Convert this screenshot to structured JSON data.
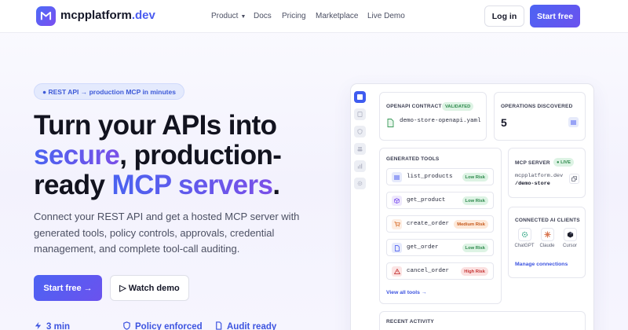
{
  "header": {
    "brand_name": "mcpplatform",
    "brand_tld": ".dev",
    "nav": [
      {
        "label": "Product",
        "has_caret": true
      },
      {
        "label": "Docs"
      },
      {
        "label": "Pricing"
      },
      {
        "label": "Marketplace"
      },
      {
        "label": "Live Demo"
      }
    ],
    "login_label": "Log in",
    "start_label": "Start free"
  },
  "hero": {
    "pill": "● REST API → production MCP in minutes",
    "headline": {
      "line1": "Turn your APIs into",
      "line2_grad": "secure",
      "line2_rest": ", production-",
      "line3_start": "ready ",
      "line3_grad": "MCP servers",
      "line3_end": "."
    },
    "subtext": "Connect your REST API and get a hosted MCP server with generated tools, policy controls, approvals, credential management, and complete tool-call auditing.",
    "cta_primary": "Start free →",
    "cta_secondary": "▷ Watch demo",
    "features": [
      "3 min",
      "Policy enforced",
      "Audit ready"
    ]
  },
  "dashboard": {
    "rail_icons": [
      "grid-icon",
      "file-icon",
      "shield-icon",
      "users-icon",
      "chart-icon",
      "gear-icon"
    ],
    "openapi": {
      "title": "OPENAPI CONTRACT",
      "badge": "VALIDATED",
      "file": "demo-store-openapi.yaml"
    },
    "operations": {
      "title": "OPERATIONS DISCOVERED",
      "count": "5"
    },
    "tools": {
      "title": "GENERATED TOOLS",
      "items": [
        {
          "name": "list_products",
          "risk": "Low Risk",
          "level": "low",
          "icon": "list-icon"
        },
        {
          "name": "get_product",
          "risk": "Low Risk",
          "level": "low",
          "icon": "box-icon"
        },
        {
          "name": "create_order",
          "risk": "Medium Risk",
          "level": "medium",
          "icon": "cart-icon"
        },
        {
          "name": "get_order",
          "risk": "Low Risk",
          "level": "low",
          "icon": "document-icon"
        },
        {
          "name": "cancel_order",
          "risk": "High Risk",
          "level": "high",
          "icon": "warning-icon"
        }
      ],
      "view_all": "View all tools →"
    },
    "server": {
      "title": "MCP SERVER",
      "status": "● LIVE",
      "host": "mcpplatform.dev",
      "path": "/demo-store"
    },
    "clients": {
      "title": "CONNECTED AI CLIENTS",
      "items": [
        "ChatGPT",
        "Claude",
        "Cursor"
      ],
      "manage": "Manage connections"
    },
    "activity": {
      "title": "RECENT ACTIVITY"
    }
  },
  "colors": {
    "accent": "#4b5cf0",
    "accent_purple": "#7a4fe8",
    "low": "#2e8a4c",
    "medium": "#c6591b",
    "high": "#c63535"
  }
}
